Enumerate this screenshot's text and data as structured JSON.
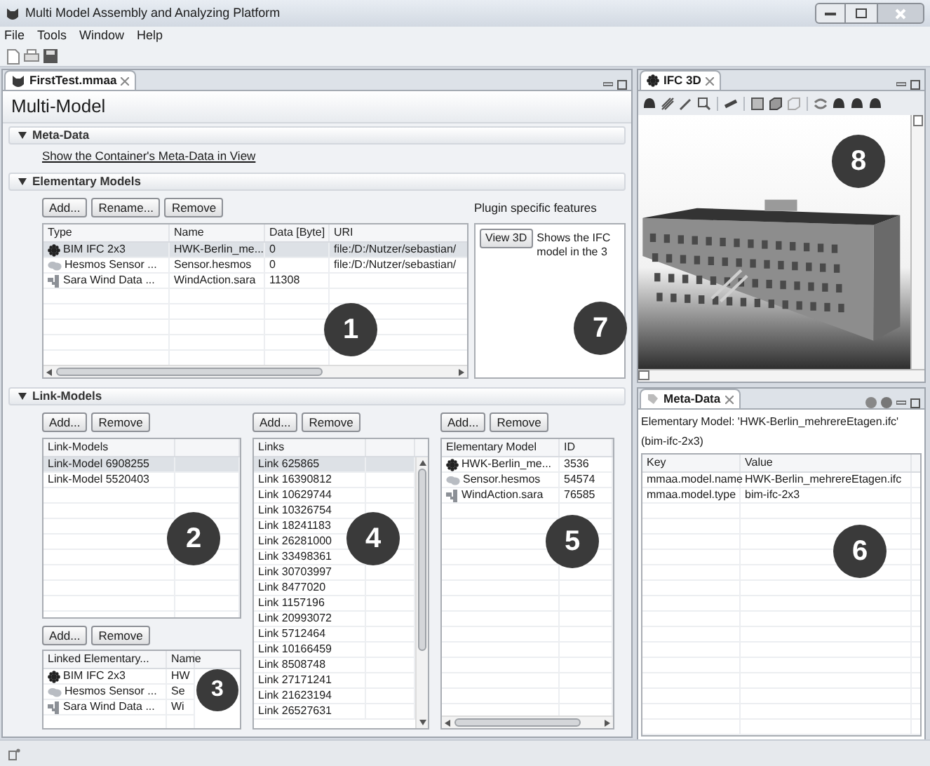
{
  "window": {
    "title": "Multi Model Assembly and Analyzing Platform"
  },
  "menu": [
    "File",
    "Tools",
    "Window",
    "Help"
  ],
  "editor": {
    "tab": {
      "label": "FirstTest.mmaa",
      "selected": true
    },
    "title": "Multi-Model",
    "badges": [
      "1",
      "7",
      "2",
      "3",
      "4",
      "5"
    ]
  },
  "meta_data_section": {
    "title": "Meta-Data",
    "expanded": true,
    "link": "Show the Container's Meta-Data in View"
  },
  "elementary_models_section": {
    "title": "Elementary Models",
    "expanded": true,
    "buttons": [
      "Add...",
      "Rename...",
      "Remove"
    ],
    "table": {
      "columns": [
        "Type",
        "Name",
        "Data [Byte]",
        "URI"
      ],
      "rows": [
        {
          "kind": "ifc",
          "selected": true,
          "cells": [
            "BIM IFC 2x3",
            "HWK-Berlin_me...",
            "0",
            "file:/D:/Nutzer/sebastian/"
          ]
        },
        {
          "kind": "sensor",
          "selected": false,
          "cells": [
            "Hesmos Sensor ...",
            "Sensor.hesmos",
            "0",
            "file:/D:/Nutzer/sebastian/"
          ]
        },
        {
          "kind": "wind",
          "selected": false,
          "cells": [
            "Sara Wind Data ...",
            "WindAction.sara",
            "11308",
            ""
          ]
        }
      ]
    },
    "plugin": {
      "title": "Plugin specific features",
      "button": "View 3D",
      "text": "Shows the IFC model in the 3"
    }
  },
  "link_models_section": {
    "title": "Link-Models",
    "expanded": true,
    "link_models": {
      "buttons": [
        "Add...",
        "Remove"
      ],
      "columns": [
        "Link-Models",
        ""
      ],
      "rows": [
        {
          "selected": true,
          "cells": [
            "Link-Model 6908255",
            ""
          ]
        },
        {
          "selected": false,
          "cells": [
            "Link-Model 5520403",
            ""
          ]
        }
      ]
    },
    "linked_models": {
      "buttons": [
        "Add...",
        "Remove"
      ],
      "columns": [
        "Linked Elementary...",
        "Name"
      ],
      "rows": [
        {
          "kind": "ifc",
          "selected": false,
          "cells": [
            "BIM IFC 2x3",
            "HW"
          ]
        },
        {
          "kind": "sensor",
          "selected": false,
          "cells": [
            "Hesmos Sensor ...",
            "Se"
          ]
        },
        {
          "kind": "wind",
          "selected": false,
          "cells": [
            "Sara Wind Data ...",
            "Wi"
          ]
        }
      ]
    },
    "links": {
      "buttons": [
        "Add...",
        "Remove"
      ],
      "columns": [
        "Links",
        ""
      ],
      "rows": [
        {
          "selected": true,
          "cells": [
            "Link 625865",
            ""
          ]
        },
        {
          "selected": false,
          "cells": [
            "Link 16390812",
            ""
          ]
        },
        {
          "selected": false,
          "cells": [
            "Link 10629744",
            ""
          ]
        },
        {
          "selected": false,
          "cells": [
            "Link 10326754",
            ""
          ]
        },
        {
          "selected": false,
          "cells": [
            "Link 18241183",
            ""
          ]
        },
        {
          "selected": false,
          "cells": [
            "Link 26281000",
            ""
          ]
        },
        {
          "selected": false,
          "cells": [
            "Link 33498361",
            ""
          ]
        },
        {
          "selected": false,
          "cells": [
            "Link 30703997",
            ""
          ]
        },
        {
          "selected": false,
          "cells": [
            "Link 8477020",
            ""
          ]
        },
        {
          "selected": false,
          "cells": [
            "Link 1157196",
            ""
          ]
        },
        {
          "selected": false,
          "cells": [
            "Link 20993072",
            ""
          ]
        },
        {
          "selected": false,
          "cells": [
            "Link 5712464",
            ""
          ]
        },
        {
          "selected": false,
          "cells": [
            "Link 10166459",
            ""
          ]
        },
        {
          "selected": false,
          "cells": [
            "Link 8508748",
            ""
          ]
        },
        {
          "selected": false,
          "cells": [
            "Link 27171241",
            ""
          ]
        },
        {
          "selected": false,
          "cells": [
            "Link 21623194",
            ""
          ]
        },
        {
          "selected": false,
          "cells": [
            "Link 26527631",
            ""
          ]
        }
      ]
    },
    "link_elements": {
      "buttons": [
        "Add...",
        "Remove"
      ],
      "columns": [
        "Elementary Model",
        "ID"
      ],
      "rows": [
        {
          "kind": "ifc",
          "selected": false,
          "cells": [
            "HWK-Berlin_me...",
            "3536"
          ]
        },
        {
          "kind": "sensor",
          "selected": false,
          "cells": [
            "Sensor.hesmos",
            "54574"
          ]
        },
        {
          "kind": "wind",
          "selected": false,
          "cells": [
            "WindAction.sara",
            "76585"
          ]
        }
      ]
    }
  },
  "ifc_view": {
    "tab": {
      "label": "IFC 3D",
      "selected": true
    },
    "badge": "8",
    "vertical_slider": {
      "level": 1
    },
    "horizontal_slider": {
      "level": 0
    }
  },
  "meta_view": {
    "tab": {
      "label": "Meta-Data",
      "selected": true
    },
    "caption": "Elementary Model: 'HWK-Berlin_mehrereEtagen.ifc' (bim-ifc-2x3)",
    "badge": "6",
    "table": {
      "columns": [
        "Key",
        "Value",
        ""
      ],
      "rows": [
        {
          "selected": false,
          "cells": [
            "mmaa.model.name",
            "HWK-Berlin_mehrereEtagen.ifc",
            ""
          ]
        },
        {
          "selected": false,
          "cells": [
            "mmaa.model.type",
            "bim-ifc-2x3",
            ""
          ]
        }
      ]
    }
  }
}
